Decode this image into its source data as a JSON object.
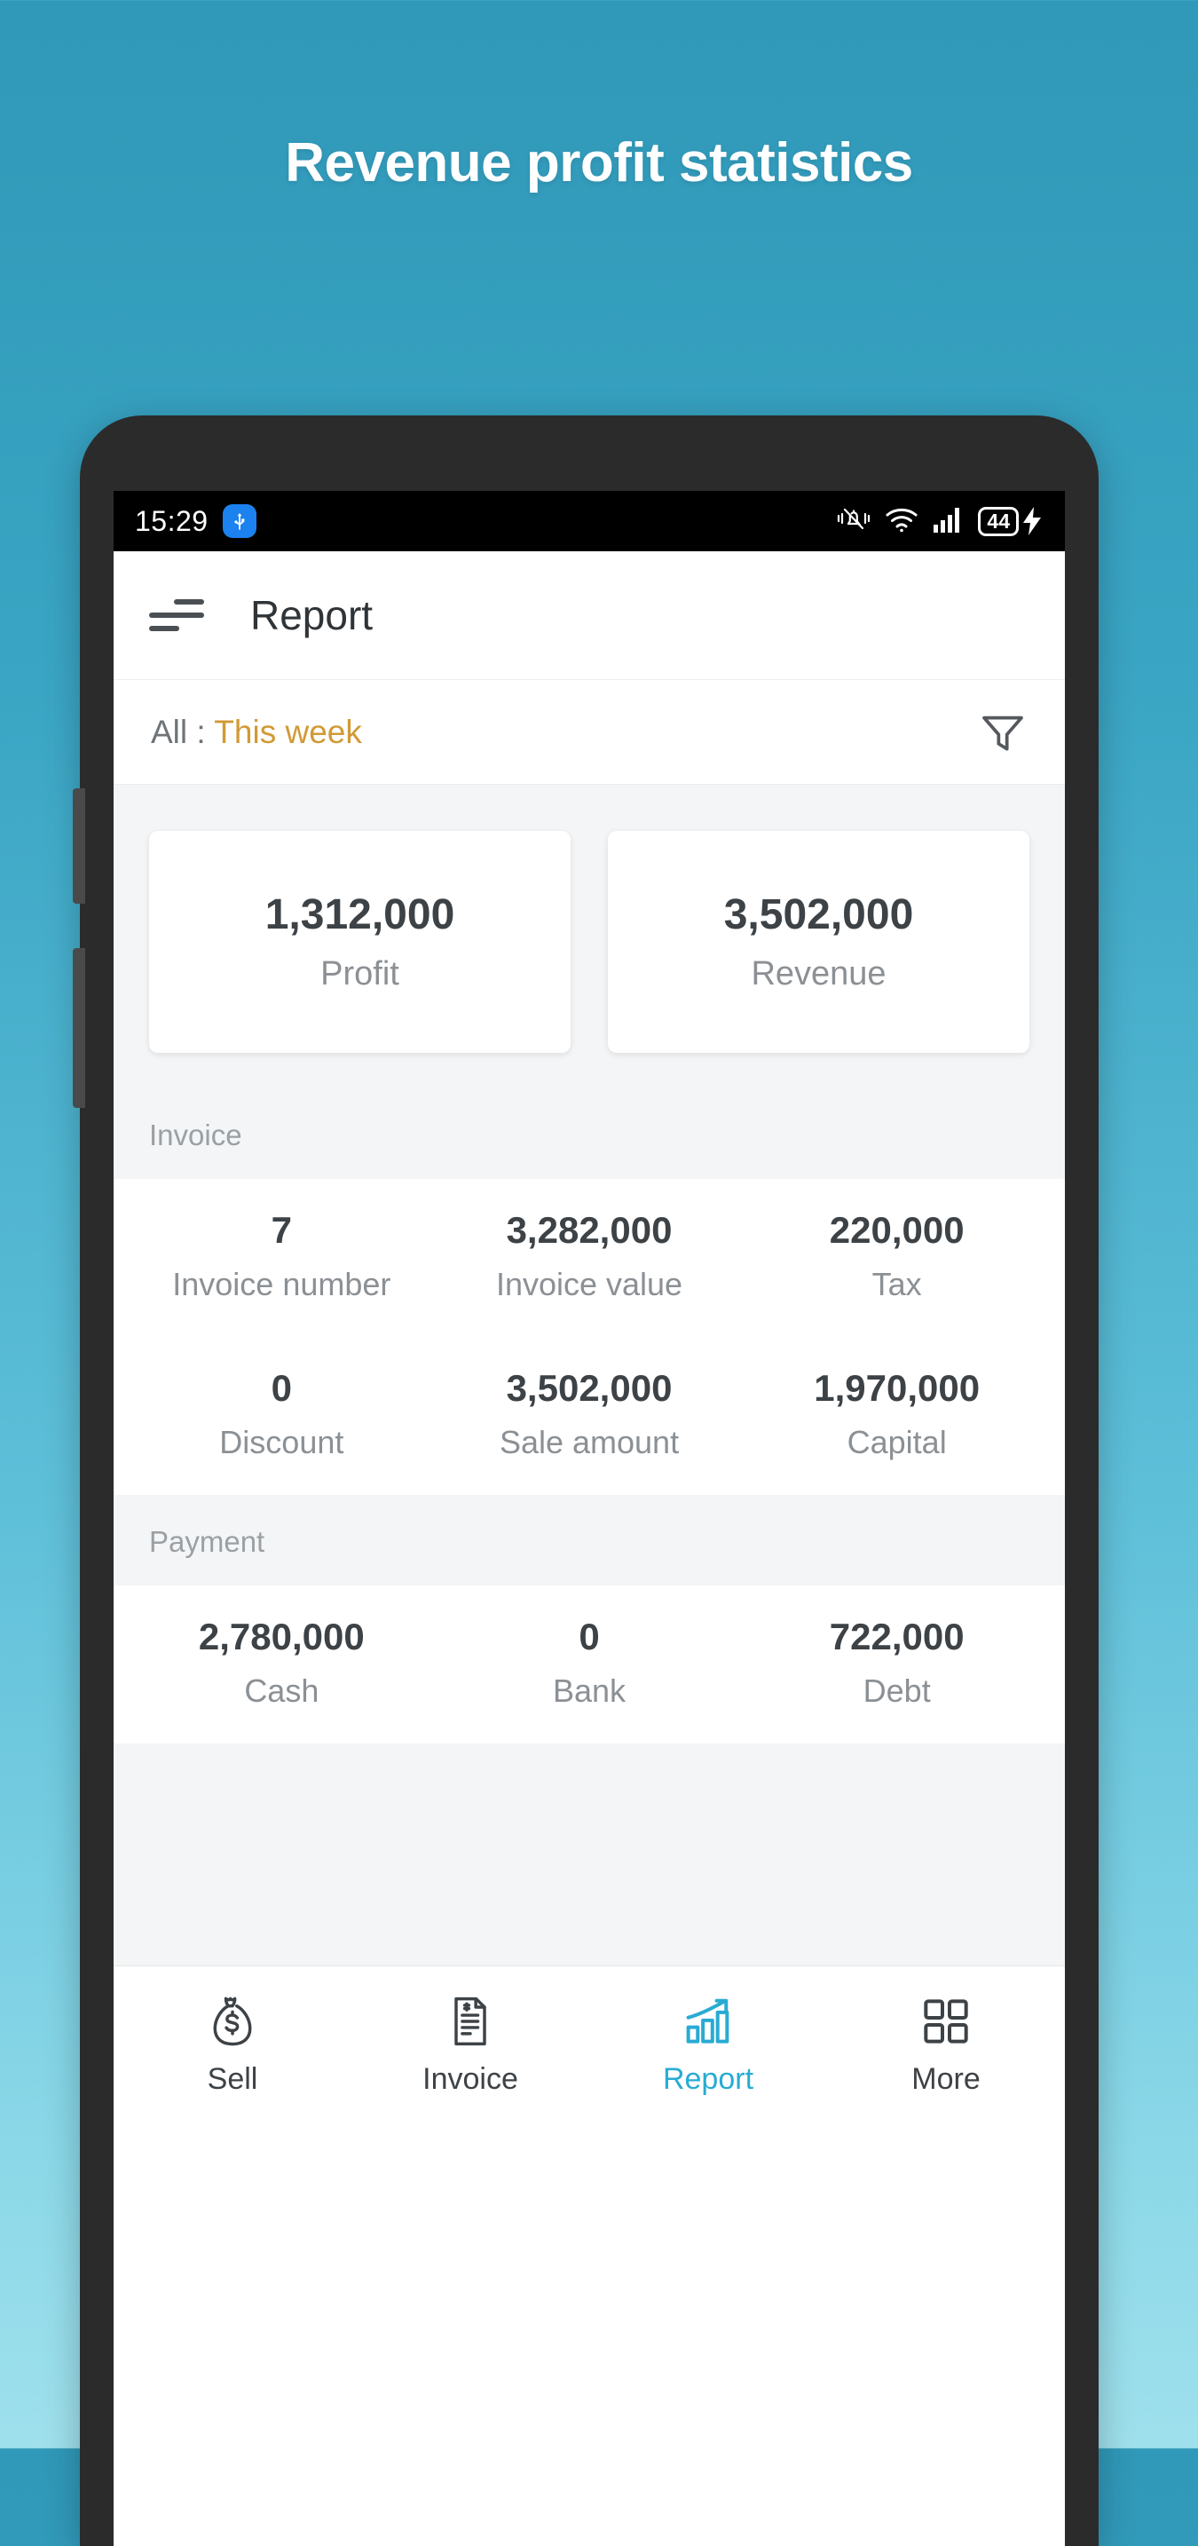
{
  "promo": {
    "title": "Revenue profit statistics"
  },
  "status_bar": {
    "time": "15:29",
    "usb_icon": "usb-icon",
    "vibrate_icon": "vibrate-off-icon",
    "wifi_icon": "wifi-icon",
    "signal_icon": "signal-bars-icon",
    "battery_level": "44",
    "charging_icon": "charging-bolt-icon"
  },
  "appbar": {
    "menu_icon": "filter-menu-icon",
    "title": "Report"
  },
  "filter": {
    "prefix": "All : ",
    "value": "This week",
    "icon": "funnel-icon",
    "accent_color": "#d19a35"
  },
  "summary_cards": [
    {
      "value": "1,312,000",
      "label": "Profit"
    },
    {
      "value": "3,502,000",
      "label": "Revenue"
    }
  ],
  "invoice": {
    "heading": "Invoice",
    "rows": [
      [
        {
          "value": "7",
          "label": "Invoice number"
        },
        {
          "value": "3,282,000",
          "label": "Invoice value"
        },
        {
          "value": "220,000",
          "label": "Tax"
        }
      ],
      [
        {
          "value": "0",
          "label": "Discount"
        },
        {
          "value": "3,502,000",
          "label": "Sale amount"
        },
        {
          "value": "1,970,000",
          "label": "Capital"
        }
      ]
    ]
  },
  "payment": {
    "heading": "Payment",
    "rows": [
      [
        {
          "value": "2,780,000",
          "label": "Cash"
        },
        {
          "value": "0",
          "label": "Bank"
        },
        {
          "value": "722,000",
          "label": "Debt"
        }
      ]
    ]
  },
  "bottom_nav": {
    "active_color": "#29abd3",
    "items": [
      {
        "label": "Sell",
        "icon": "money-bag-icon",
        "active": false
      },
      {
        "label": "Invoice",
        "icon": "document-icon",
        "active": false
      },
      {
        "label": "Report",
        "icon": "bar-chart-growth-icon",
        "active": true
      },
      {
        "label": "More",
        "icon": "grid-icon",
        "active": false
      }
    ]
  }
}
